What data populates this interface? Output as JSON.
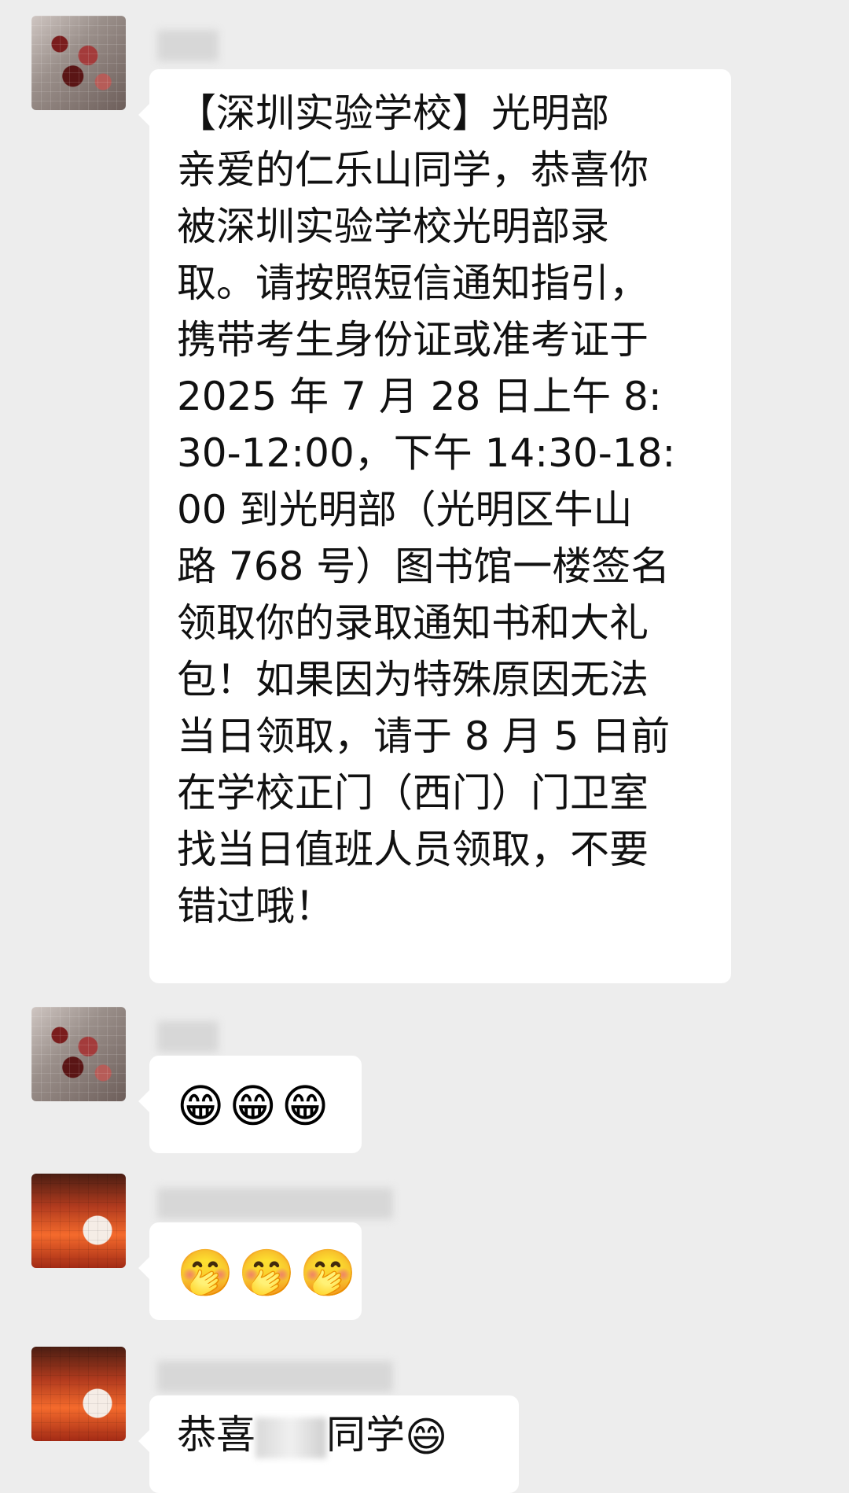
{
  "messages": [
    {
      "sender": "",
      "text": "【深圳实验学校】光明部\n亲爱的仁乐山同学，恭喜你\n被深圳实验学校光明部录\n取。请按照短信通知指引，\n携带考生身份证或准考证于\n2025 年 7 月 28 日上午 8:\n30-12:00，下午 14:30-18:\n00 到光明部（光明区牛山\n路 768 号）图书馆一楼签名\n领取你的录取通知书和大礼\n包！如果因为特殊原因无法\n当日领取，请于 8 月 5 日前\n在学校正门（西门）门卫室\n找当日值班人员领取，不要\n错过哦！"
    },
    {
      "sender": "",
      "emoji": "😁😁😁"
    },
    {
      "sender": "",
      "emoji": "🤭🤭🤭"
    },
    {
      "sender": "",
      "prefix": "恭喜",
      "suffix": "同学",
      "emoji": "😄"
    }
  ]
}
